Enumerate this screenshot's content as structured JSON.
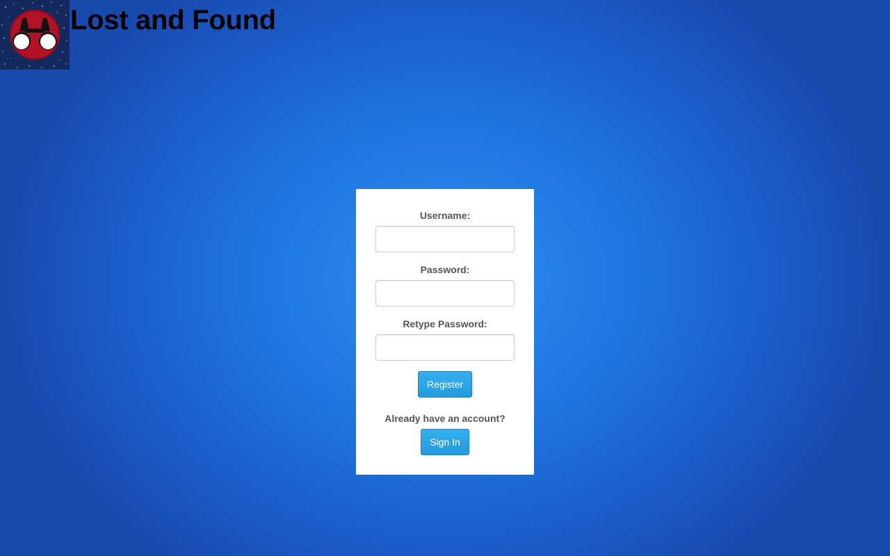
{
  "header": {
    "title": "Lost and Found",
    "logo_icon": "binoculars-icon"
  },
  "colors": {
    "background": "#2177e0",
    "panel": "#ffffff",
    "button": "#229bdf",
    "label_text": "#555555"
  },
  "form": {
    "username_label": "Username:",
    "username_value": "",
    "password_label": "Password:",
    "password_value": "",
    "retype_label": "Retype Password:",
    "retype_value": "",
    "register_label": "Register",
    "account_prompt": "Already have an account?",
    "signin_label": "Sign In"
  }
}
